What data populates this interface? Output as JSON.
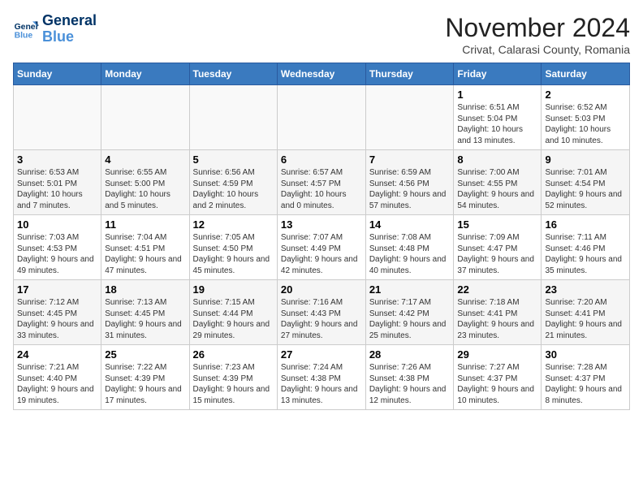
{
  "header": {
    "logo_line1": "General",
    "logo_line2": "Blue",
    "month_title": "November 2024",
    "subtitle": "Crivat, Calarasi County, Romania"
  },
  "days_of_week": [
    "Sunday",
    "Monday",
    "Tuesday",
    "Wednesday",
    "Thursday",
    "Friday",
    "Saturday"
  ],
  "weeks": [
    [
      {
        "day": "",
        "info": ""
      },
      {
        "day": "",
        "info": ""
      },
      {
        "day": "",
        "info": ""
      },
      {
        "day": "",
        "info": ""
      },
      {
        "day": "",
        "info": ""
      },
      {
        "day": "1",
        "info": "Sunrise: 6:51 AM\nSunset: 5:04 PM\nDaylight: 10 hours and 13 minutes."
      },
      {
        "day": "2",
        "info": "Sunrise: 6:52 AM\nSunset: 5:03 PM\nDaylight: 10 hours and 10 minutes."
      }
    ],
    [
      {
        "day": "3",
        "info": "Sunrise: 6:53 AM\nSunset: 5:01 PM\nDaylight: 10 hours and 7 minutes."
      },
      {
        "day": "4",
        "info": "Sunrise: 6:55 AM\nSunset: 5:00 PM\nDaylight: 10 hours and 5 minutes."
      },
      {
        "day": "5",
        "info": "Sunrise: 6:56 AM\nSunset: 4:59 PM\nDaylight: 10 hours and 2 minutes."
      },
      {
        "day": "6",
        "info": "Sunrise: 6:57 AM\nSunset: 4:57 PM\nDaylight: 10 hours and 0 minutes."
      },
      {
        "day": "7",
        "info": "Sunrise: 6:59 AM\nSunset: 4:56 PM\nDaylight: 9 hours and 57 minutes."
      },
      {
        "day": "8",
        "info": "Sunrise: 7:00 AM\nSunset: 4:55 PM\nDaylight: 9 hours and 54 minutes."
      },
      {
        "day": "9",
        "info": "Sunrise: 7:01 AM\nSunset: 4:54 PM\nDaylight: 9 hours and 52 minutes."
      }
    ],
    [
      {
        "day": "10",
        "info": "Sunrise: 7:03 AM\nSunset: 4:53 PM\nDaylight: 9 hours and 49 minutes."
      },
      {
        "day": "11",
        "info": "Sunrise: 7:04 AM\nSunset: 4:51 PM\nDaylight: 9 hours and 47 minutes."
      },
      {
        "day": "12",
        "info": "Sunrise: 7:05 AM\nSunset: 4:50 PM\nDaylight: 9 hours and 45 minutes."
      },
      {
        "day": "13",
        "info": "Sunrise: 7:07 AM\nSunset: 4:49 PM\nDaylight: 9 hours and 42 minutes."
      },
      {
        "day": "14",
        "info": "Sunrise: 7:08 AM\nSunset: 4:48 PM\nDaylight: 9 hours and 40 minutes."
      },
      {
        "day": "15",
        "info": "Sunrise: 7:09 AM\nSunset: 4:47 PM\nDaylight: 9 hours and 37 minutes."
      },
      {
        "day": "16",
        "info": "Sunrise: 7:11 AM\nSunset: 4:46 PM\nDaylight: 9 hours and 35 minutes."
      }
    ],
    [
      {
        "day": "17",
        "info": "Sunrise: 7:12 AM\nSunset: 4:45 PM\nDaylight: 9 hours and 33 minutes."
      },
      {
        "day": "18",
        "info": "Sunrise: 7:13 AM\nSunset: 4:45 PM\nDaylight: 9 hours and 31 minutes."
      },
      {
        "day": "19",
        "info": "Sunrise: 7:15 AM\nSunset: 4:44 PM\nDaylight: 9 hours and 29 minutes."
      },
      {
        "day": "20",
        "info": "Sunrise: 7:16 AM\nSunset: 4:43 PM\nDaylight: 9 hours and 27 minutes."
      },
      {
        "day": "21",
        "info": "Sunrise: 7:17 AM\nSunset: 4:42 PM\nDaylight: 9 hours and 25 minutes."
      },
      {
        "day": "22",
        "info": "Sunrise: 7:18 AM\nSunset: 4:41 PM\nDaylight: 9 hours and 23 minutes."
      },
      {
        "day": "23",
        "info": "Sunrise: 7:20 AM\nSunset: 4:41 PM\nDaylight: 9 hours and 21 minutes."
      }
    ],
    [
      {
        "day": "24",
        "info": "Sunrise: 7:21 AM\nSunset: 4:40 PM\nDaylight: 9 hours and 19 minutes."
      },
      {
        "day": "25",
        "info": "Sunrise: 7:22 AM\nSunset: 4:39 PM\nDaylight: 9 hours and 17 minutes."
      },
      {
        "day": "26",
        "info": "Sunrise: 7:23 AM\nSunset: 4:39 PM\nDaylight: 9 hours and 15 minutes."
      },
      {
        "day": "27",
        "info": "Sunrise: 7:24 AM\nSunset: 4:38 PM\nDaylight: 9 hours and 13 minutes."
      },
      {
        "day": "28",
        "info": "Sunrise: 7:26 AM\nSunset: 4:38 PM\nDaylight: 9 hours and 12 minutes."
      },
      {
        "day": "29",
        "info": "Sunrise: 7:27 AM\nSunset: 4:37 PM\nDaylight: 9 hours and 10 minutes."
      },
      {
        "day": "30",
        "info": "Sunrise: 7:28 AM\nSunset: 4:37 PM\nDaylight: 9 hours and 8 minutes."
      }
    ]
  ]
}
